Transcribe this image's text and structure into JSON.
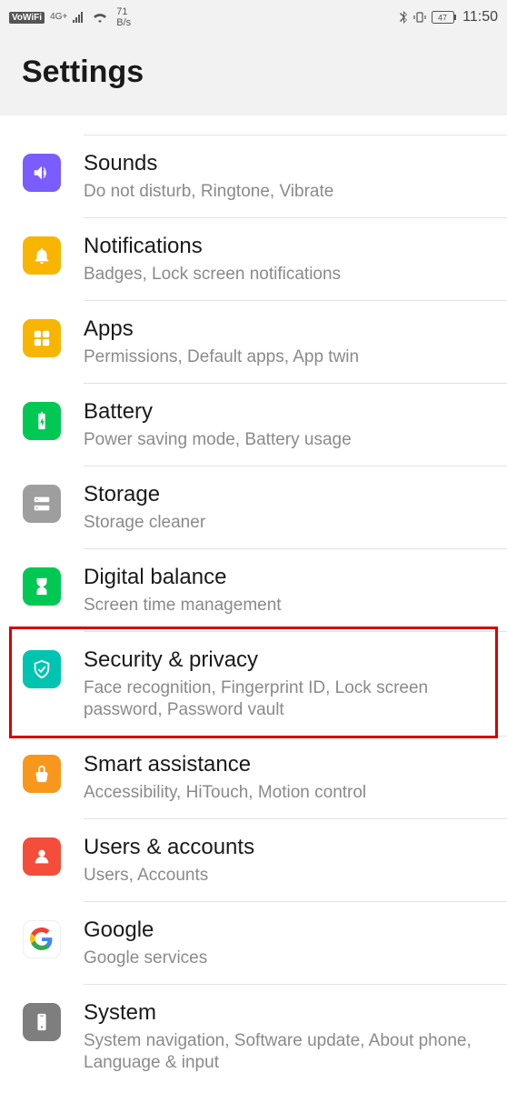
{
  "status": {
    "vowifi": "VoWiFi",
    "net": "4G+",
    "speed_top": "71",
    "speed_bot": "B/s",
    "battery": "47",
    "time": "11:50"
  },
  "header": {
    "title": "Settings"
  },
  "items": {
    "sounds": {
      "title": "Sounds",
      "sub": "Do not disturb, Ringtone, Vibrate"
    },
    "notifications": {
      "title": "Notifications",
      "sub": "Badges, Lock screen notifications"
    },
    "apps": {
      "title": "Apps",
      "sub": "Permissions, Default apps, App twin"
    },
    "battery": {
      "title": "Battery",
      "sub": "Power saving mode, Battery usage"
    },
    "storage": {
      "title": "Storage",
      "sub": "Storage cleaner"
    },
    "digital": {
      "title": "Digital balance",
      "sub": "Screen time management"
    },
    "security": {
      "title": "Security & privacy",
      "sub": "Face recognition, Fingerprint ID, Lock screen password, Password vault"
    },
    "smart": {
      "title": "Smart assistance",
      "sub": "Accessibility, HiTouch, Motion control"
    },
    "users": {
      "title": "Users & accounts",
      "sub": "Users, Accounts"
    },
    "google": {
      "title": "Google",
      "sub": "Google services"
    },
    "system": {
      "title": "System",
      "sub": "System navigation, Software update, About phone, Language & input"
    }
  },
  "highlight": {
    "target": "security"
  }
}
